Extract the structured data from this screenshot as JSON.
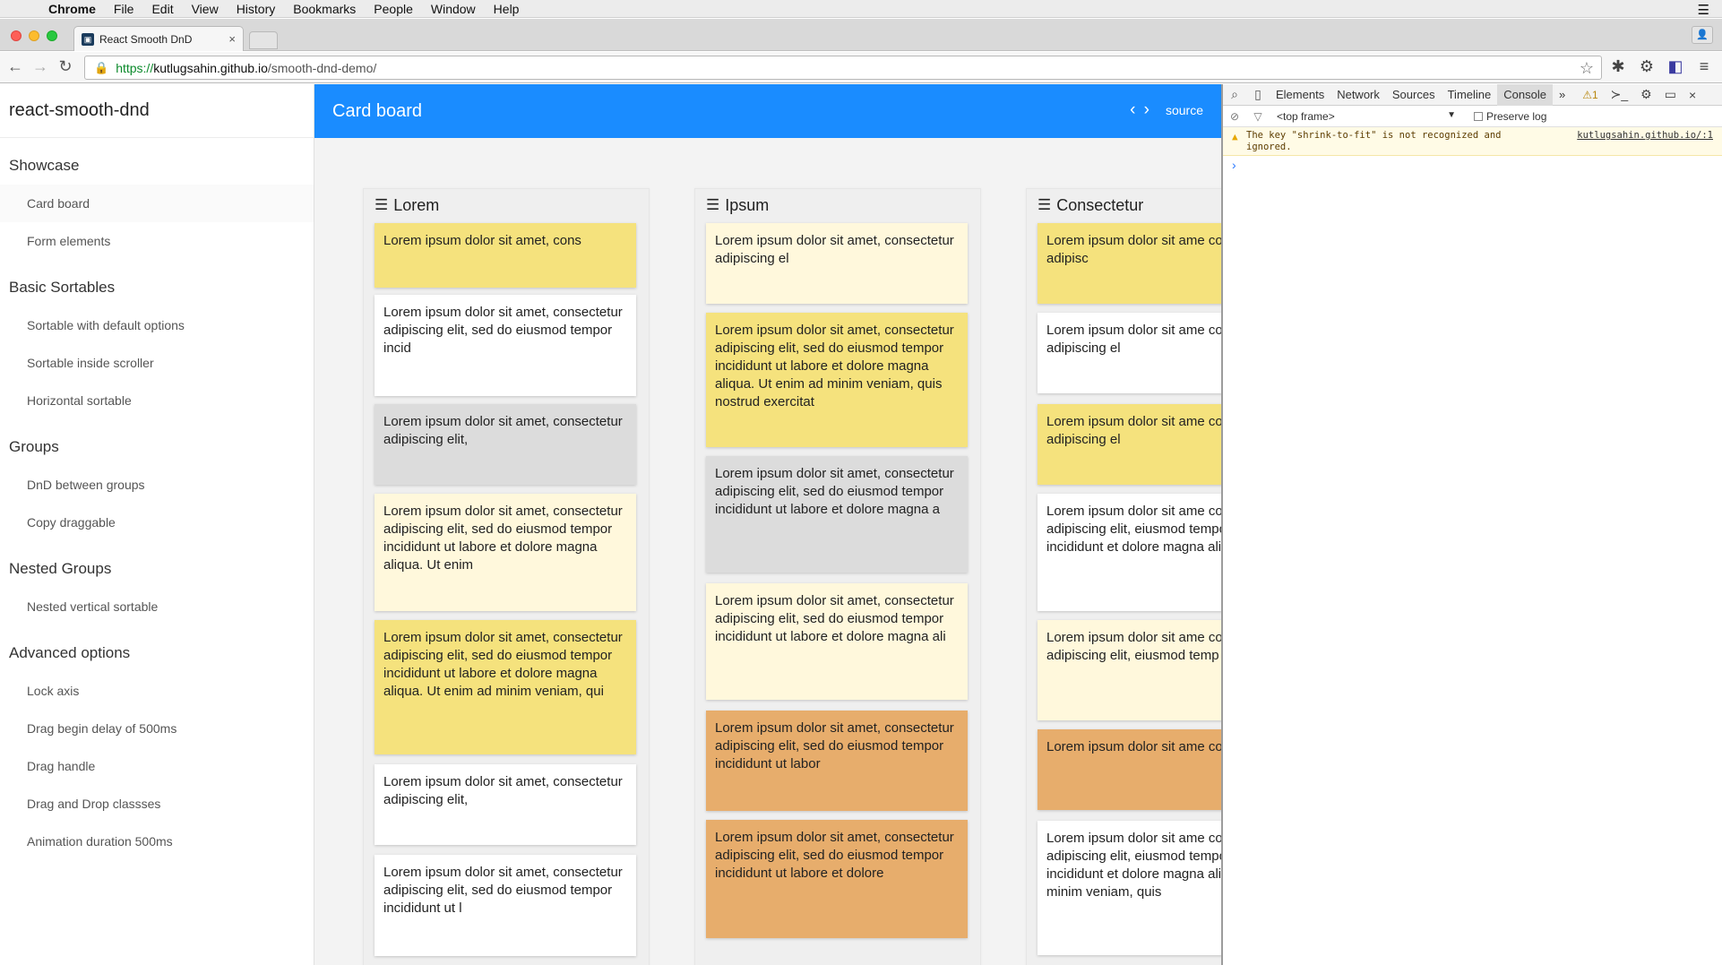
{
  "menubar": {
    "app": "Chrome",
    "items": [
      "File",
      "Edit",
      "View",
      "History",
      "Bookmarks",
      "People",
      "Window",
      "Help"
    ]
  },
  "browser": {
    "tab_title": "React Smooth DnD",
    "url_scheme": "https://",
    "url_host": "kutlugsahin.github.io",
    "url_path": "/smooth-dnd-demo/"
  },
  "sidebar": {
    "brand": "react-smooth-dnd",
    "sections": [
      {
        "title": "Showcase",
        "items": [
          "Card board",
          "Form elements"
        ]
      },
      {
        "title": "Basic Sortables",
        "items": [
          "Sortable with default options",
          "Sortable inside scroller",
          "Horizontal sortable"
        ]
      },
      {
        "title": "Groups",
        "items": [
          "DnD between groups",
          "Copy draggable"
        ]
      },
      {
        "title": "Nested Groups",
        "items": [
          "Nested vertical sortable"
        ]
      },
      {
        "title": "Advanced options",
        "items": [
          "Lock axis",
          "Drag begin delay of 500ms",
          "Drag handle",
          "Drag and Drop classses",
          "Animation duration 500ms"
        ]
      }
    ]
  },
  "header": {
    "title": "Card board",
    "source_label": "source"
  },
  "board": {
    "columns": [
      {
        "title": "Lorem",
        "cards": [
          {
            "text": "Lorem ipsum dolor sit amet, cons",
            "color": "#f5e27d"
          },
          {
            "text": "Lorem ipsum dolor sit amet, consectetur adipiscing elit, sed do eiusmod tempor incid",
            "color": "#ffffff"
          },
          {
            "text": "Lorem ipsum dolor sit amet, consectetur adipiscing elit,",
            "color": "#dcdcdc"
          },
          {
            "text": "Lorem ipsum dolor sit amet, consectetur adipiscing elit, sed do eiusmod tempor incididunt ut labore et dolore magna aliqua. Ut enim",
            "color": "#fff8dc"
          },
          {
            "text": "Lorem ipsum dolor sit amet, consectetur adipiscing elit, sed do eiusmod tempor incididunt ut labore et dolore magna aliqua. Ut enim ad minim veniam, qui",
            "color": "#f5e27d"
          },
          {
            "text": "Lorem ipsum dolor sit amet, consectetur adipiscing elit,",
            "color": "#ffffff"
          },
          {
            "text": "Lorem ipsum dolor sit amet, consectetur adipiscing elit, sed do eiusmod tempor incididunt ut l",
            "color": "#ffffff"
          }
        ]
      },
      {
        "title": "Ipsum",
        "cards": [
          {
            "text": "Lorem ipsum dolor sit amet, consectetur adipiscing el",
            "color": "#fff8dc"
          },
          {
            "text": "Lorem ipsum dolor sit amet, consectetur adipiscing elit, sed do eiusmod tempor incididunt ut labore et dolore magna aliqua. Ut enim ad minim veniam, quis nostrud exercitat",
            "color": "#f5e27d"
          },
          {
            "text": "Lorem ipsum dolor sit amet, consectetur adipiscing elit, sed do eiusmod tempor incididunt ut labore et dolore magna a",
            "color": "#dcdcdc"
          },
          {
            "text": "Lorem ipsum dolor sit amet, consectetur adipiscing elit, sed do eiusmod tempor incididunt ut labore et dolore magna ali",
            "color": "#fff8dc"
          },
          {
            "text": "Lorem ipsum dolor sit amet, consectetur adipiscing elit, sed do eiusmod tempor incididunt ut labor",
            "color": "#e7ad6c"
          },
          {
            "text": "Lorem ipsum dolor sit amet, consectetur adipiscing elit, sed do eiusmod tempor incididunt ut labore et dolore",
            "color": "#e7ad6c"
          }
        ]
      },
      {
        "title": "Consectetur",
        "cards": [
          {
            "text": "Lorem ipsum dolor sit ame consectetur adipisc",
            "color": "#f5e27d"
          },
          {
            "text": "Lorem ipsum dolor sit ame consectetur adipiscing el",
            "color": "#ffffff"
          },
          {
            "text": "Lorem ipsum dolor sit ame consectetur adipiscing el",
            "color": "#f5e27d"
          },
          {
            "text": "Lorem ipsum dolor sit ame consectetur adipiscing elit, eiusmod tempor incididunt et dolore magna aliqua. U",
            "color": "#ffffff"
          },
          {
            "text": "Lorem ipsum dolor sit ame consectetur adipiscing elit, eiusmod temp",
            "color": "#fff8dc"
          },
          {
            "text": "Lorem ipsum dolor sit ame consectetu",
            "color": "#e7ad6c"
          },
          {
            "text": "Lorem ipsum dolor sit ame consectetur adipiscing elit, eiusmod tempor incididunt et dolore magna aliqua. Ut minim veniam, quis",
            "color": "#ffffff"
          }
        ]
      }
    ]
  },
  "devtools": {
    "tabs": [
      "Elements",
      "Network",
      "Sources",
      "Timeline",
      "Console"
    ],
    "active_tab": "Console",
    "more": "»",
    "warning_count": "1",
    "frame": "<top frame>",
    "preserve_log": "Preserve log",
    "warning_message": "The key \"shrink-to-fit\" is not recognized and ignored.",
    "warning_source": "kutlugsahin.github.io/:1",
    "prompt": "›"
  }
}
